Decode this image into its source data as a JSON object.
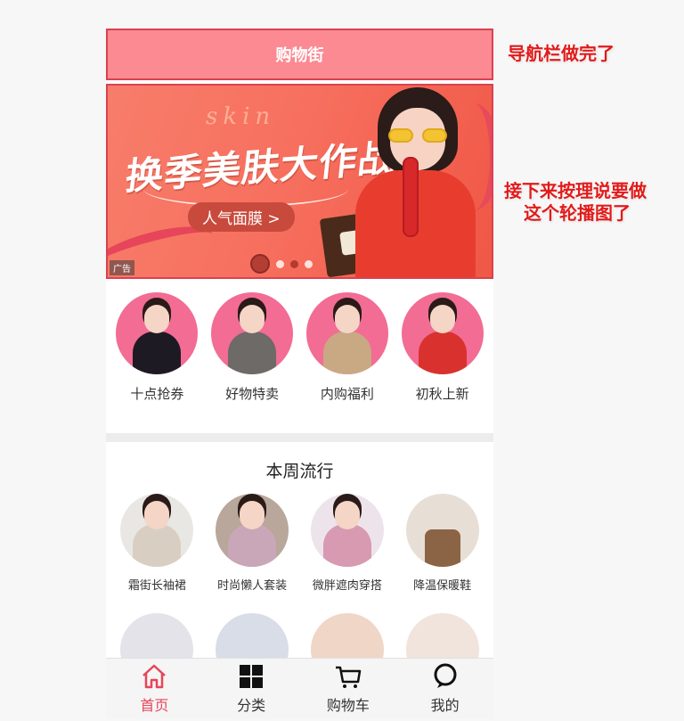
{
  "navbar": {
    "title": "购物街"
  },
  "banner": {
    "headline": "换季美肤大作战",
    "script_text": "skin",
    "button_label": "人气面膜 >",
    "ad_badge": "广告",
    "dots": 5,
    "active_dot": 0
  },
  "categories": [
    {
      "label": "十点抢券",
      "outfit_color": "#1e1a24"
    },
    {
      "label": "好物特卖",
      "outfit_color": "#6d6a68"
    },
    {
      "label": "内购福利",
      "outfit_color": "#c9a884"
    },
    {
      "label": "初秋上新",
      "outfit_color": "#d9322e"
    }
  ],
  "weekly": {
    "title": "本周流行",
    "items": [
      {
        "label": "霜街长袖裙",
        "bg": "#e9e7e4",
        "tone": "#d8cfc2"
      },
      {
        "label": "时尚懒人套装",
        "bg": "#b8a79a",
        "tone": "#c9a7b8"
      },
      {
        "label": "微胖遮肉穿搭",
        "bg": "#ece4ea",
        "tone": "#d79ab0"
      },
      {
        "label": "降温保暖鞋",
        "bg": "#e7dfd6",
        "tone": "#8b6446"
      }
    ],
    "row2": [
      {
        "bg": "#e4e3ea"
      },
      {
        "bg": "#d8dde8"
      },
      {
        "bg": "#f0d6c6"
      },
      {
        "bg": "#f0e4dc"
      }
    ]
  },
  "tabbar": {
    "tabs": [
      {
        "label": "首页",
        "icon": "home-icon",
        "active": true
      },
      {
        "label": "分类",
        "icon": "grid-icon",
        "active": false
      },
      {
        "label": "购物车",
        "icon": "cart-icon",
        "active": false
      },
      {
        "label": "我的",
        "icon": "chat-bubble-icon",
        "active": false
      }
    ]
  },
  "annotations": {
    "note1": "导航栏做完了",
    "note2_line1": "接下来按理说要做",
    "note2_line2": "这个轮播图了"
  },
  "colors": {
    "accent": "#fb8a93",
    "active_tab": "#e8455a",
    "annotation": "#e11b1b"
  }
}
